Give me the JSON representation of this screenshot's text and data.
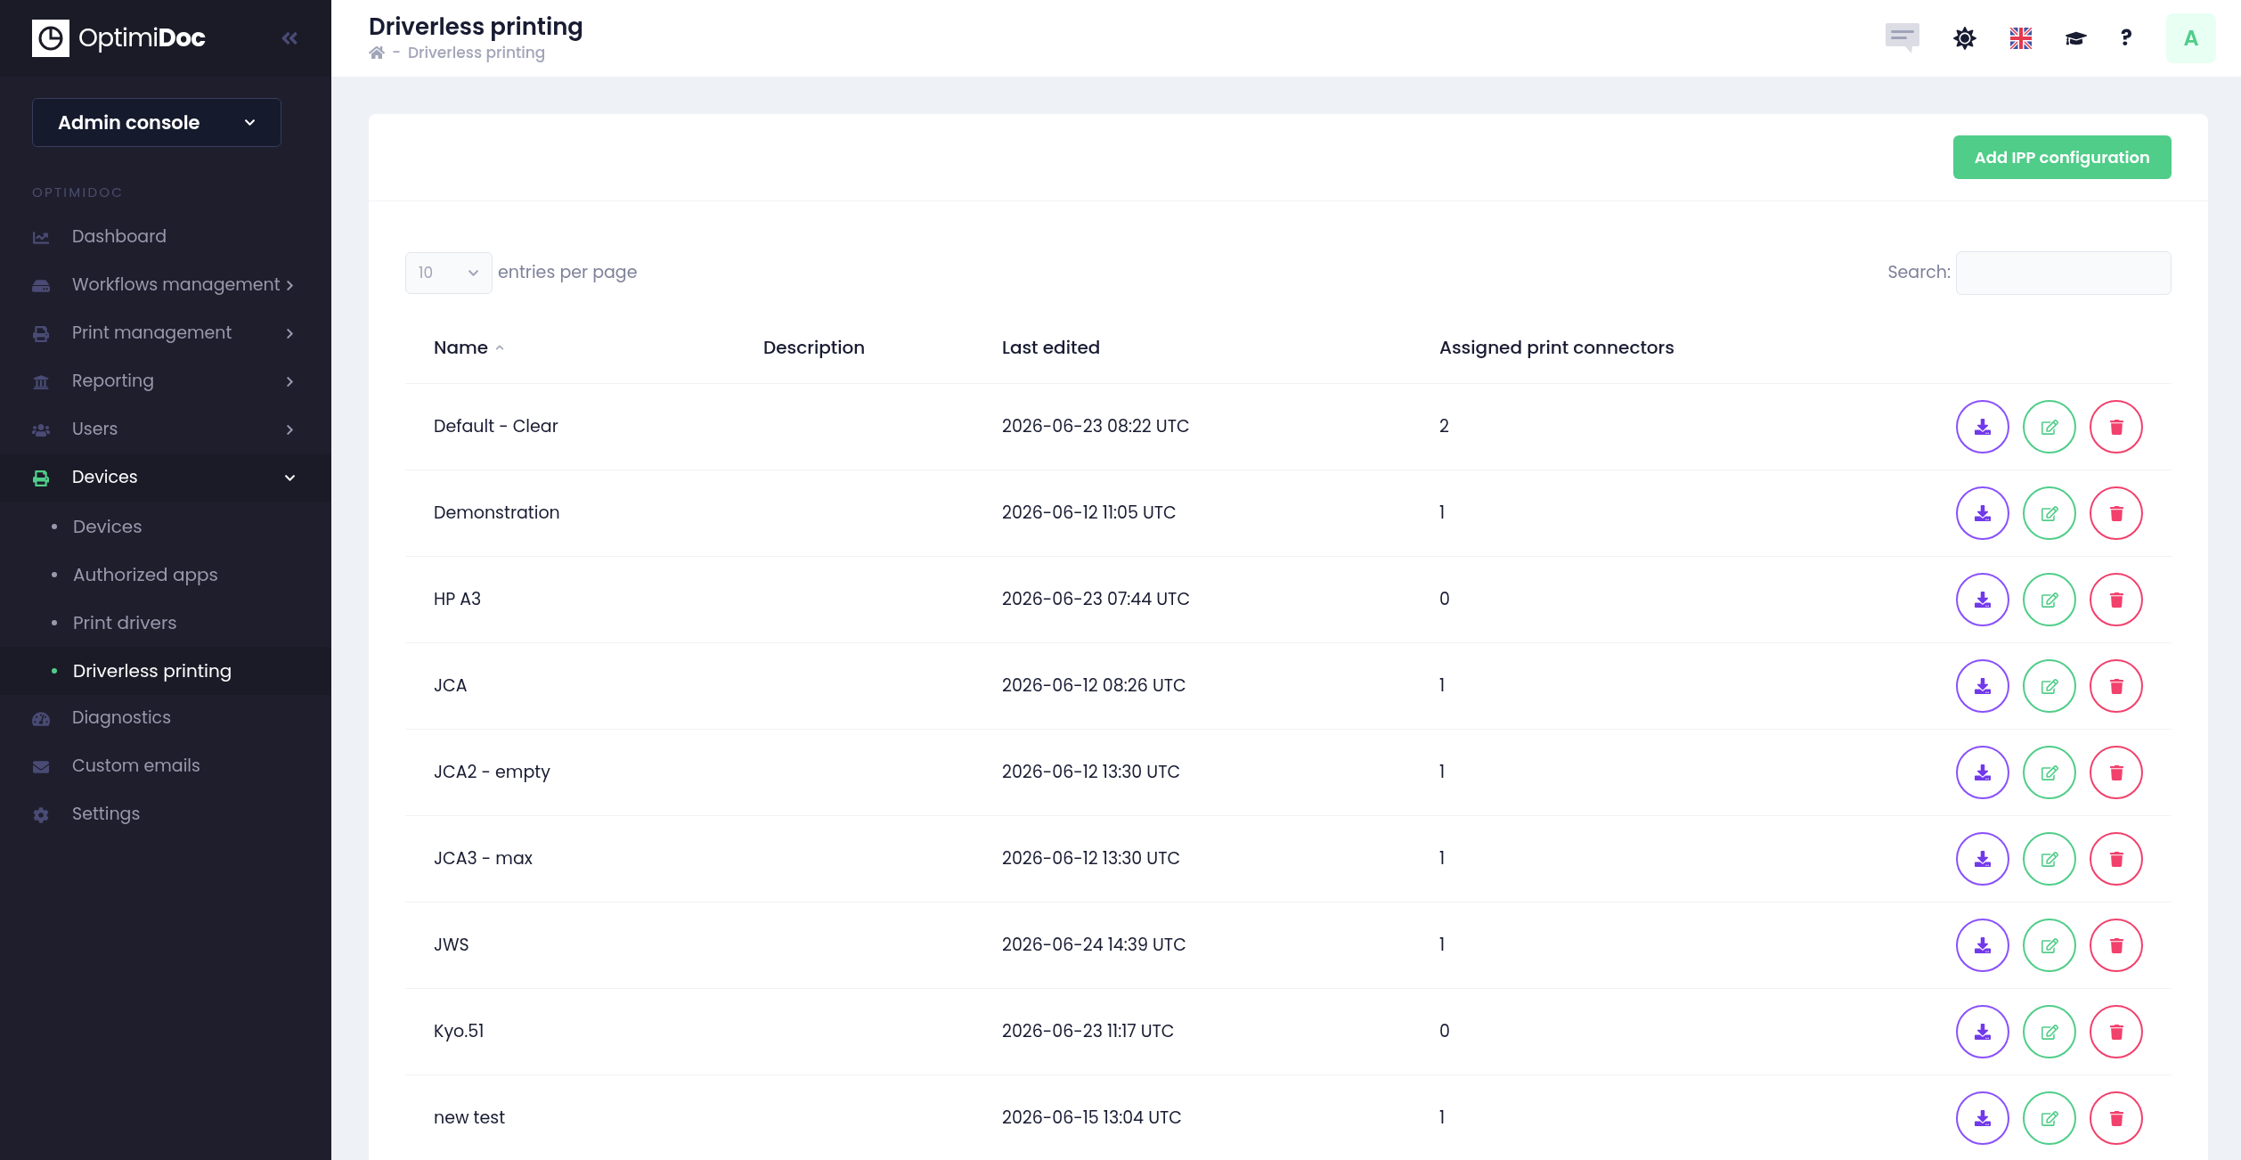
{
  "sidebar": {
    "logo": {
      "light": "Optimi",
      "bold": "Doc"
    },
    "console_select": "Admin console",
    "section_label": "OPTIMIDOC",
    "items": [
      {
        "label": "Dashboard",
        "has_children": false,
        "selected": false
      },
      {
        "label": "Workflows management",
        "has_children": true,
        "expanded": false,
        "selected": false
      },
      {
        "label": "Print management",
        "has_children": true,
        "expanded": false,
        "selected": false
      },
      {
        "label": "Reporting",
        "has_children": true,
        "expanded": false,
        "selected": false
      },
      {
        "label": "Users",
        "has_children": true,
        "expanded": false,
        "selected": false
      },
      {
        "label": "Devices",
        "has_children": true,
        "expanded": true,
        "selected": true,
        "children": [
          {
            "label": "Devices",
            "selected": false
          },
          {
            "label": "Authorized apps",
            "selected": false
          },
          {
            "label": "Print drivers",
            "selected": false
          },
          {
            "label": "Driverless printing",
            "selected": true
          }
        ]
      },
      {
        "label": "Diagnostics",
        "has_children": false,
        "selected": false
      },
      {
        "label": "Custom emails",
        "has_children": false,
        "selected": false
      },
      {
        "label": "Settings",
        "has_children": false,
        "selected": false
      }
    ]
  },
  "header": {
    "title": "Driverless printing",
    "breadcrumb": [
      "-",
      "Driverless printing"
    ],
    "avatar": "A",
    "help": "?"
  },
  "toolbar": {
    "add_button": "Add IPP configuration",
    "page_size": "10",
    "page_size_label": "entries per page",
    "search_label": "Search:"
  },
  "table": {
    "columns": [
      {
        "label": "Name",
        "sorted": true
      },
      {
        "label": "Description",
        "sorted": false
      },
      {
        "label": "Last edited",
        "sorted": false
      },
      {
        "label": "Assigned print connectors",
        "sorted": false
      }
    ],
    "rows": [
      {
        "name": "Default - Clear",
        "last_edited": "2026-06-23 08:22 UTC",
        "assigned_print_connectors": "2"
      },
      {
        "name": "Demonstration",
        "last_edited": "2026-06-12 11:05 UTC",
        "assigned_print_connectors": "1"
      },
      {
        "name": "HP A3",
        "last_edited": "2026-06-23 07:44 UTC",
        "assigned_print_connectors": "0"
      },
      {
        "name": "JCA",
        "last_edited": "2026-06-12 08:26 UTC",
        "assigned_print_connectors": "1"
      },
      {
        "name": "JCA2 - empty",
        "last_edited": "2026-06-12 13:30 UTC",
        "assigned_print_connectors": "1"
      },
      {
        "name": "JCA3 - max",
        "last_edited": "2026-06-12 13:30 UTC",
        "assigned_print_connectors": "1"
      },
      {
        "name": "JWS",
        "last_edited": "2026-06-24 14:39 UTC",
        "assigned_print_connectors": "1"
      },
      {
        "name": "Kyo.51",
        "last_edited": "2026-06-23 11:17 UTC",
        "assigned_print_connectors": "0"
      },
      {
        "name": "new test",
        "last_edited": "2026-06-15 13:04 UTC",
        "assigned_print_connectors": "1"
      }
    ]
  }
}
